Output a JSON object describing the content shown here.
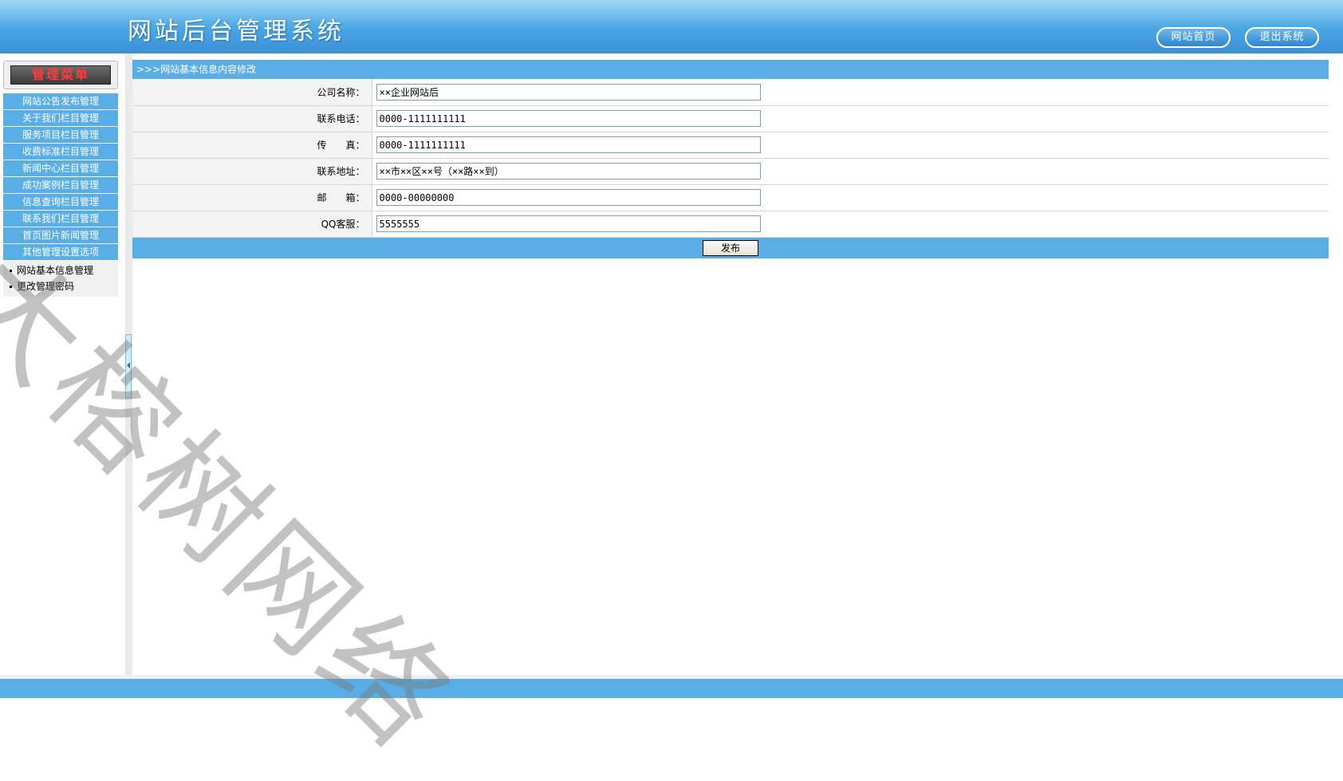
{
  "header": {
    "title": "网站后台管理系统",
    "home_button": "网站首页",
    "exit_button": "退出系统"
  },
  "sidebar": {
    "menu_title": "管理菜单",
    "items": [
      {
        "label": "网站公告发布管理"
      },
      {
        "label": "关于我们栏目管理"
      },
      {
        "label": "服务项目栏目管理"
      },
      {
        "label": "收费标准栏目管理"
      },
      {
        "label": "新闻中心栏目管理"
      },
      {
        "label": "成功案例栏目管理"
      },
      {
        "label": "信息查询栏目管理"
      },
      {
        "label": "联系我们栏目管理"
      },
      {
        "label": "首页图片新闻管理"
      },
      {
        "label": "其他管理设置选项"
      }
    ],
    "sub_items": [
      {
        "label": "网站基本信息管理"
      },
      {
        "label": "更改管理密码"
      }
    ]
  },
  "main": {
    "breadcrumb": ">>>网站基本信息内容修改",
    "fields": [
      {
        "label": "公司名称：",
        "value": "××企业网站后"
      },
      {
        "label": "联系电话：",
        "value": "0000-1111111111"
      },
      {
        "label": "传　　真：",
        "value": "0000-1111111111"
      },
      {
        "label": "联系地址：",
        "value": "××市××区××号（××路××到）"
      },
      {
        "label": "邮　　箱：",
        "value": "0000-00000000"
      },
      {
        "label": "QQ客服：",
        "value": "5555555"
      }
    ],
    "submit_label": "发布"
  },
  "watermark": "大榕树网络",
  "colors": {
    "header_blue": "#4aa6e3",
    "menu_blue": "#5aaee6",
    "menu_title_text": "#ff3b3b"
  }
}
